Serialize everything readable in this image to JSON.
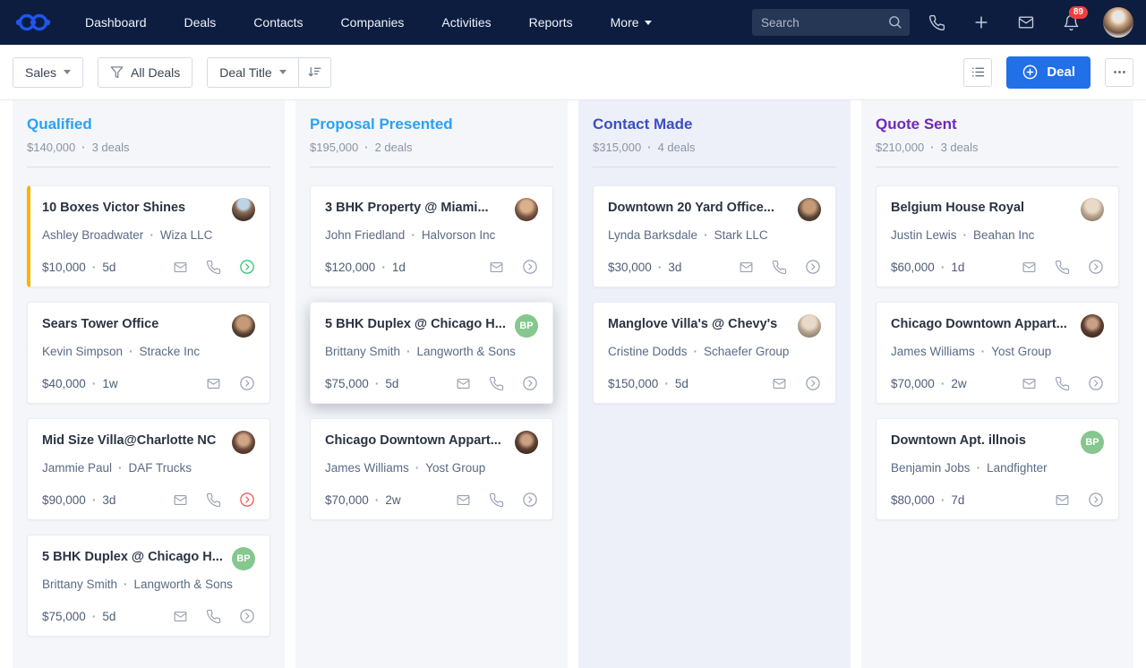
{
  "navbar": {
    "nav_items": [
      "Dashboard",
      "Deals",
      "Contacts",
      "Companies",
      "Activities",
      "Reports"
    ],
    "more_label": "More",
    "search_placeholder": "Search",
    "notification_count": "89",
    "right_icons": [
      "phone-icon",
      "plus-icon",
      "mail-icon",
      "bell-icon"
    ],
    "colors": {
      "background": "#0d1d40",
      "logo": "#1e56f0",
      "badge": "#f03e3e"
    }
  },
  "toolbar": {
    "pipeline_label": "Sales",
    "filter_label": "All Deals",
    "sort_field_label": "Deal Title",
    "deal_button_label": "Deal",
    "deal_button_color": "#2170e8"
  },
  "board": {
    "columns": [
      {
        "title": "Qualified",
        "color": "#29a2f5",
        "total": "$140,000",
        "count_label": "3 deals",
        "cards": [
          {
            "title": "10 Boxes Victor Shines",
            "contact": "Ashley Broadwater",
            "company": "Wiza LLC",
            "amount": "$10,000",
            "age": "5d",
            "actions": [
              "mail",
              "phone",
              "advance-green"
            ],
            "avatar": {
              "kind": "photo",
              "variant": 1
            },
            "accent": "#f7b500"
          },
          {
            "title": "Sears Tower Office",
            "contact": "Kevin Simpson",
            "company": "Stracke Inc",
            "amount": "$40,000",
            "age": "1w",
            "actions": [
              "mail",
              "advance"
            ],
            "avatar": {
              "kind": "photo",
              "variant": 2
            }
          },
          {
            "title": "Mid Size Villa@Charlotte NC",
            "contact": "Jammie Paul",
            "company": "DAF Trucks",
            "amount": "$90,000",
            "age": "3d",
            "actions": [
              "mail",
              "phone",
              "advance-red"
            ],
            "avatar": {
              "kind": "photo",
              "variant": 3
            }
          },
          {
            "title": "5 BHK Duplex @ Chicago H...",
            "contact": "Brittany Smith",
            "company": "Langworth & Sons",
            "amount": "$75,000",
            "age": "5d",
            "actions": [
              "mail",
              "phone",
              "advance"
            ],
            "avatar": {
              "kind": "initials",
              "text": "BP",
              "color": "#85c78f"
            }
          }
        ]
      },
      {
        "title": "Proposal Presented",
        "color": "#29a2f5",
        "total": "$195,000",
        "count_label": "2 deals",
        "cards": [
          {
            "title": "3 BHK Property @ Miami...",
            "contact": "John Friedland",
            "company": "Halvorson Inc",
            "amount": "$120,000",
            "age": "1d",
            "actions": [
              "mail",
              "advance"
            ],
            "avatar": {
              "kind": "photo",
              "variant": 4
            }
          },
          {
            "title": "5 BHK Duplex @ Chicago H...",
            "contact": "Brittany Smith",
            "company": "Langworth & Sons",
            "amount": "$75,000",
            "age": "5d",
            "actions": [
              "mail",
              "phone",
              "advance"
            ],
            "avatar": {
              "kind": "initials",
              "text": "BP",
              "color": "#85c78f"
            },
            "elevated": true
          },
          {
            "title": "Chicago Downtown Appart...",
            "contact": "James Williams",
            "company": "Yost Group",
            "amount": "$70,000",
            "age": "2w",
            "actions": [
              "mail",
              "phone",
              "advance"
            ],
            "avatar": {
              "kind": "photo",
              "variant": 5
            }
          }
        ]
      },
      {
        "title": "Contact Made",
        "color": "#3c4ec0",
        "total": "$315,000",
        "count_label": "4 deals",
        "panel_tint": "#edf0f8",
        "cards": [
          {
            "title": "Downtown 20 Yard Office...",
            "contact": "Lynda Barksdale",
            "company": "Stark LLC",
            "amount": "$30,000",
            "age": "3d",
            "actions": [
              "mail",
              "phone",
              "advance"
            ],
            "avatar": {
              "kind": "photo",
              "variant": 2
            }
          },
          {
            "title": "Manglove Villa's @ Chevy's",
            "contact": "Cristine Dodds",
            "company": "Schaefer Group",
            "amount": "$150,000",
            "age": "5d",
            "actions": [
              "mail",
              "advance"
            ],
            "avatar": {
              "kind": "photo",
              "variant": 6
            }
          }
        ]
      },
      {
        "title": "Quote Sent",
        "color": "#7127ba",
        "total": "$210,000",
        "count_label": "3 deals",
        "cards": [
          {
            "title": "Belgium House Royal",
            "contact": "Justin Lewis",
            "company": "Beahan Inc",
            "amount": "$60,000",
            "age": "1d",
            "actions": [
              "mail",
              "phone",
              "advance"
            ],
            "avatar": {
              "kind": "photo",
              "variant": 6
            }
          },
          {
            "title": "Chicago Downtown Appart...",
            "contact": "James Williams",
            "company": "Yost Group",
            "amount": "$70,000",
            "age": "2w",
            "actions": [
              "mail",
              "phone",
              "advance"
            ],
            "avatar": {
              "kind": "photo",
              "variant": 5
            }
          },
          {
            "title": "Downtown Apt. illnois",
            "contact": "Benjamin Jobs",
            "company": "Landfighter",
            "amount": "$80,000",
            "age": "7d",
            "actions": [
              "mail",
              "advance"
            ],
            "avatar": {
              "kind": "initials",
              "text": "BP",
              "color": "#85c78f"
            }
          }
        ]
      }
    ]
  },
  "action_colors": {
    "advance": "#96a0b0",
    "advance-green": "#21c06b",
    "advance-red": "#ef4b4b"
  }
}
